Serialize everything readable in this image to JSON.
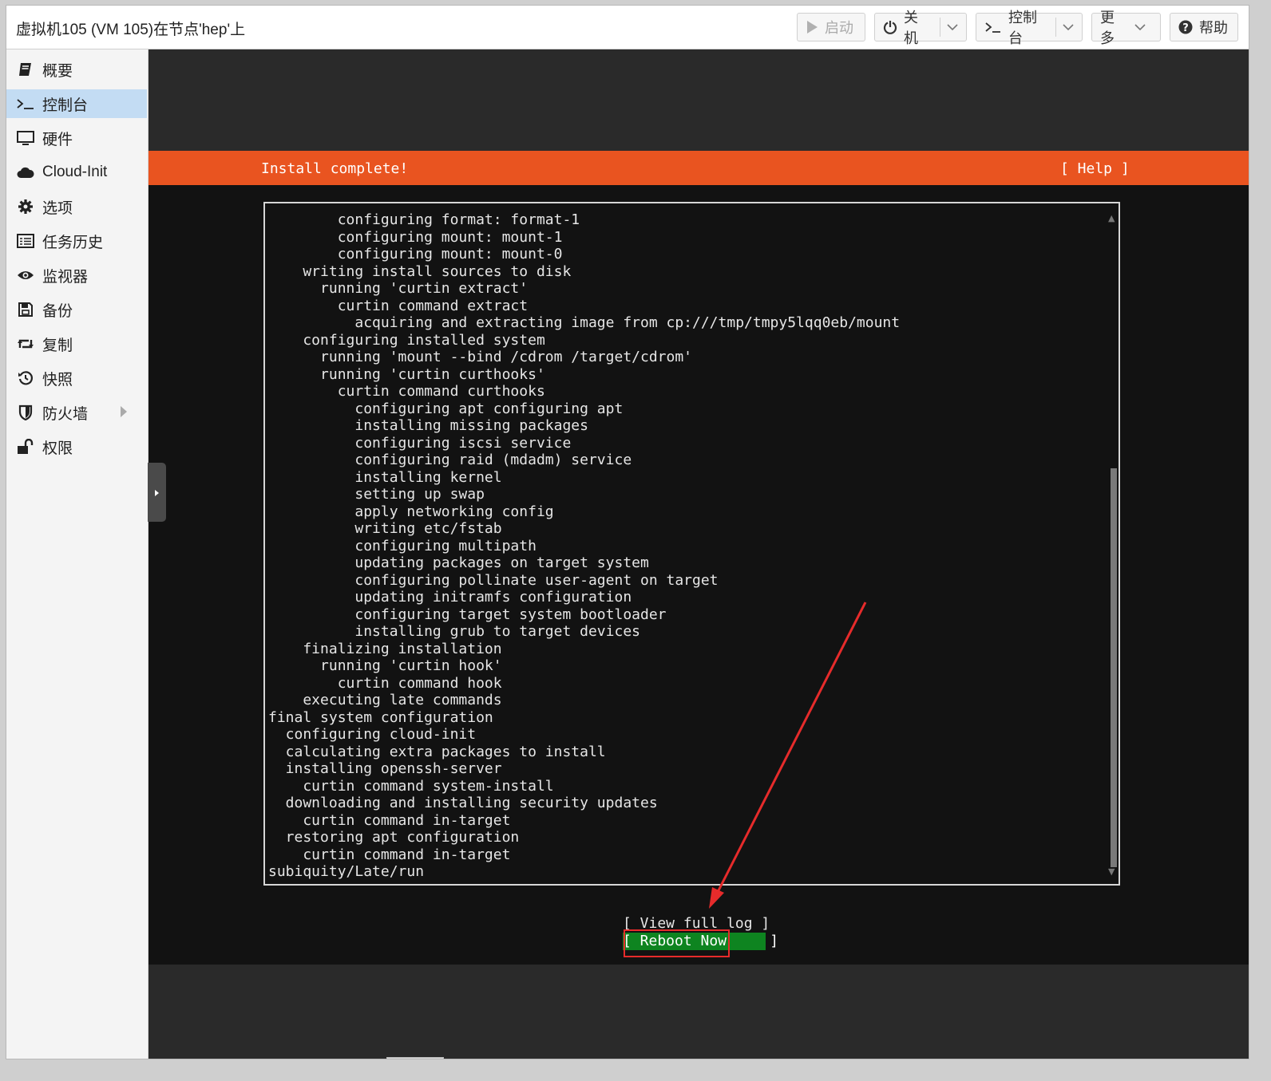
{
  "header": {
    "title": "虚拟机105 (VM 105)在节点'hep'上",
    "buttons": {
      "start": "启动",
      "shutdown": "关机",
      "console": "控制台",
      "more": "更多",
      "help": "帮助"
    }
  },
  "sidebar": {
    "items": [
      {
        "label": "概要",
        "icon": "book-icon"
      },
      {
        "label": "控制台",
        "icon": "terminal-icon",
        "active": true
      },
      {
        "label": "硬件",
        "icon": "monitor-icon"
      },
      {
        "label": "Cloud-Init",
        "icon": "cloud-icon"
      },
      {
        "label": "选项",
        "icon": "gear-icon"
      },
      {
        "label": "任务历史",
        "icon": "list-icon"
      },
      {
        "label": "监视器",
        "icon": "eye-icon"
      },
      {
        "label": "备份",
        "icon": "floppy-icon"
      },
      {
        "label": "复制",
        "icon": "retweet-icon"
      },
      {
        "label": "快照",
        "icon": "history-icon"
      },
      {
        "label": "防火墙",
        "icon": "shield-icon"
      },
      {
        "label": "权限",
        "icon": "unlock-icon"
      }
    ]
  },
  "installer": {
    "title": "Install complete!",
    "help": "[ Help ]",
    "log_lines": [
      "        configuring format: format-1",
      "        configuring mount: mount-1",
      "        configuring mount: mount-0",
      "    writing install sources to disk",
      "      running 'curtin extract'",
      "        curtin command extract",
      "          acquiring and extracting image from cp:///tmp/tmpy5lqq0eb/mount",
      "    configuring installed system",
      "      running 'mount --bind /cdrom /target/cdrom'",
      "      running 'curtin curthooks'",
      "        curtin command curthooks",
      "          configuring apt configuring apt",
      "          installing missing packages",
      "          configuring iscsi service",
      "          configuring raid (mdadm) service",
      "          installing kernel",
      "          setting up swap",
      "          apply networking config",
      "          writing etc/fstab",
      "          configuring multipath",
      "          updating packages on target system",
      "          configuring pollinate user-agent on target",
      "          updating initramfs configuration",
      "          configuring target system bootloader",
      "          installing grub to target devices",
      "    finalizing installation",
      "      running 'curtin hook'",
      "        curtin command hook",
      "    executing late commands",
      "final system configuration",
      "  configuring cloud-init",
      "  calculating extra packages to install",
      "  installing openssh-server",
      "    curtin command system-install",
      "  downloading and installing security updates",
      "    curtin command in-target",
      "  restoring apt configuration",
      "    curtin command in-target",
      "subiquity/Late/run"
    ],
    "view_log": "[ View full log ]",
    "reboot": "[ Reboot Now     ]"
  },
  "colors": {
    "orange": "#e95420",
    "green": "#0e8420",
    "annotation_red": "#e62b2b",
    "sidebar_active": "#c3dcf3"
  }
}
